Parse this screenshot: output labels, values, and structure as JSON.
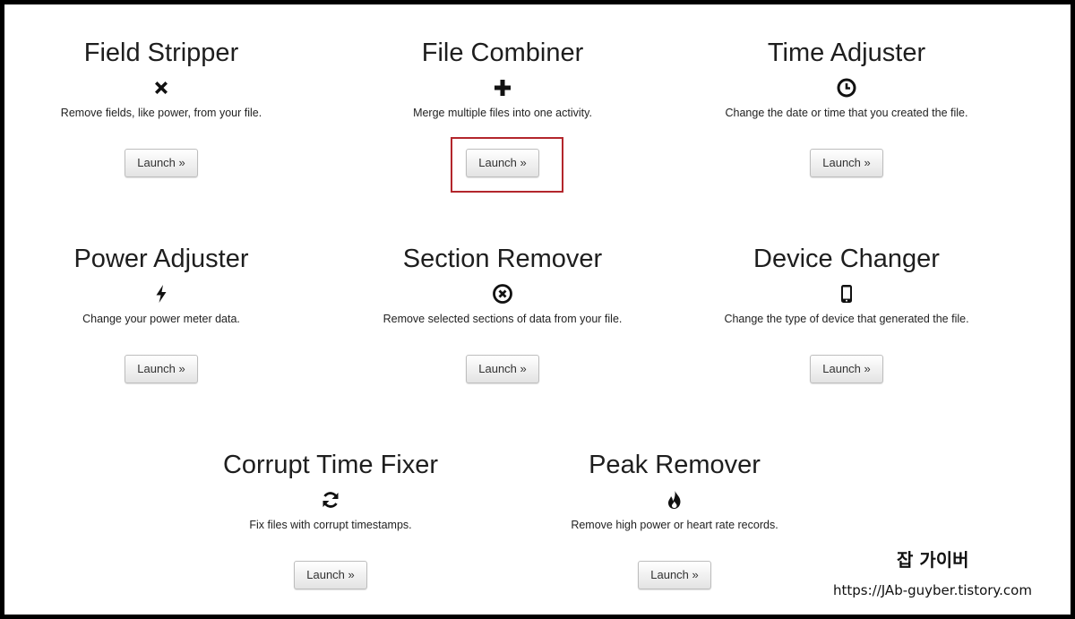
{
  "tools": [
    {
      "title": "Field Stripper",
      "icon": "close-icon",
      "description": "Remove fields, like power, from your file.",
      "button": "Launch »"
    },
    {
      "title": "File Combiner",
      "icon": "plus-icon",
      "description": "Merge multiple files into one activity.",
      "button": "Launch »"
    },
    {
      "title": "Time Adjuster",
      "icon": "clock-icon",
      "description": "Change the date or time that you created the file.",
      "button": "Launch »"
    },
    {
      "title": "Power Adjuster",
      "icon": "lightning-icon",
      "description": "Change your power meter data.",
      "button": "Launch »"
    },
    {
      "title": "Section Remover",
      "icon": "circle-x-icon",
      "description": "Remove selected sections of data from your file.",
      "button": "Launch »"
    },
    {
      "title": "Device Changer",
      "icon": "mobile-device-icon",
      "description": "Change the type of device that generated the file.",
      "button": "Launch »"
    },
    {
      "title": "Corrupt Time Fixer",
      "icon": "refresh-icon",
      "description": "Fix files with corrupt timestamps.",
      "button": "Launch »"
    },
    {
      "title": "Peak Remover",
      "icon": "fire-icon",
      "description": "Remove high power or heart rate records.",
      "button": "Launch »"
    }
  ],
  "highlight_color": "#b3262c",
  "watermark": {
    "title": "잡 가이버",
    "url": "https://JAb-guyber.tistory.com"
  }
}
